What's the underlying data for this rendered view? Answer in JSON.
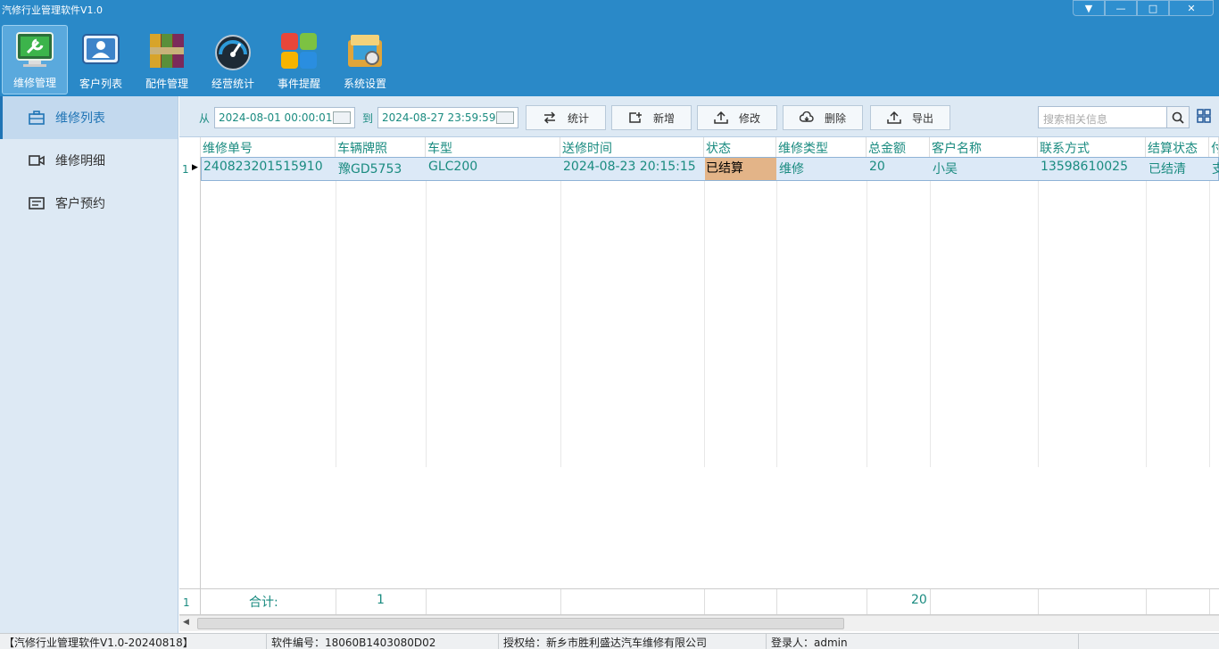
{
  "window": {
    "title": "汽修行业管理软件V1.0"
  },
  "ribbon": {
    "items": [
      {
        "label": "维修管理",
        "icon": "monitor-wrench-icon"
      },
      {
        "label": "客户列表",
        "icon": "customer-icon"
      },
      {
        "label": "配件管理",
        "icon": "parts-icon"
      },
      {
        "label": "经营统计",
        "icon": "gauge-icon"
      },
      {
        "label": "事件提醒",
        "icon": "reminder-icon"
      },
      {
        "label": "系统设置",
        "icon": "settings-icon"
      }
    ]
  },
  "sidebar": {
    "items": [
      {
        "label": "维修列表",
        "icon": "briefcase-icon"
      },
      {
        "label": "维修明细",
        "icon": "video-icon"
      },
      {
        "label": "客户预约",
        "icon": "note-icon"
      }
    ]
  },
  "toolbar": {
    "from_label": "从",
    "from_value": "2024-08-01 00:00:01",
    "to_label": "到",
    "to_value": "2024-08-27 23:59:59",
    "stats_label": "统计",
    "add_label": "新增",
    "edit_label": "修改",
    "delete_label": "删除",
    "export_label": "导出",
    "search_placeholder": "搜索相关信息"
  },
  "grid": {
    "columns": [
      "维修单号",
      "车辆牌照",
      "车型",
      "送修时间",
      "状态",
      "维修类型",
      "总金额",
      "客户名称",
      "联系方式",
      "结算状态",
      "付"
    ],
    "rows": [
      {
        "num": "1",
        "cells": [
          "240823201515910",
          "豫GD5753",
          "GLC200",
          "2024-08-23 20:15:15",
          "已结算",
          "维修",
          "20",
          "客户名称-小吴",
          "13598610025",
          "已结清",
          "支"
        ]
      }
    ],
    "footer": {
      "num": "1",
      "label": "合计:",
      "count": "1",
      "amount": "20"
    }
  },
  "statusbar": {
    "version": "【汽修行业管理软件V1.0-20240818】",
    "serial": "软件编号：18060B1403080D02",
    "licensee": "授权给：新乡市胜利盛达汽车维修有限公司",
    "user": "登录人：admin"
  }
}
